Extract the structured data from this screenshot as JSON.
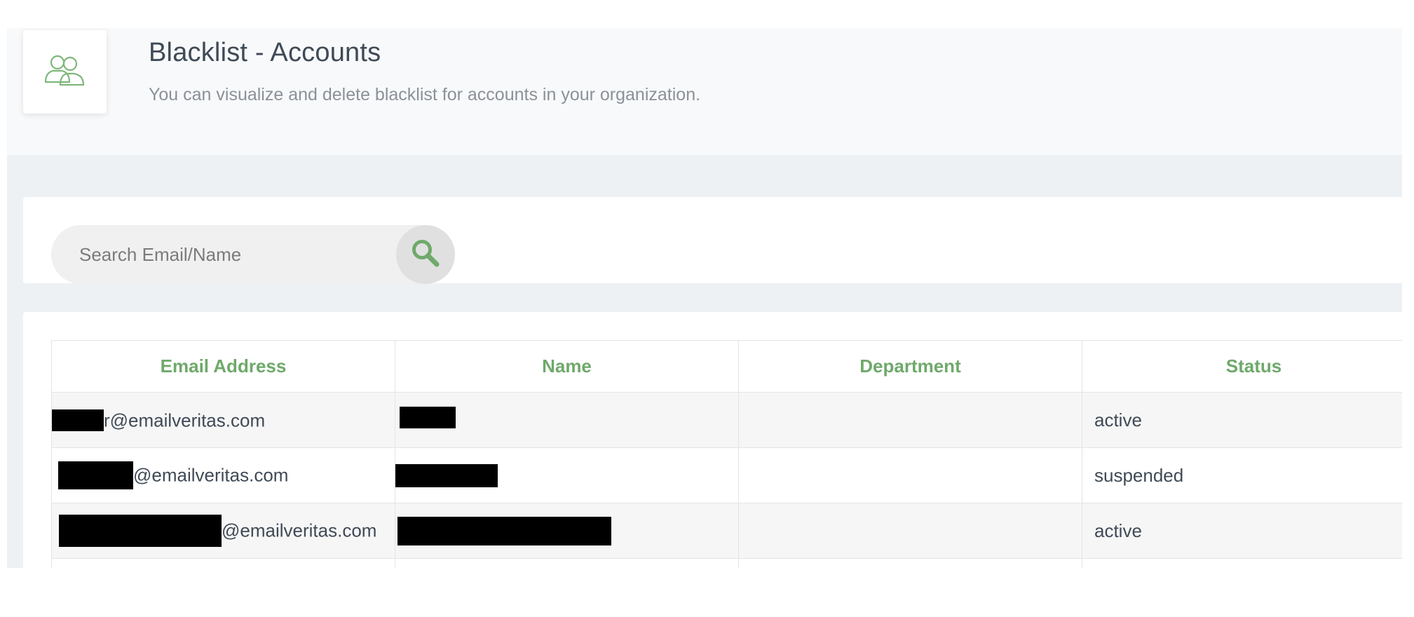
{
  "header": {
    "title": "Blacklist - Accounts",
    "subtitle": "You can visualize and delete blacklist for accounts in your organization.",
    "icon": "users-icon",
    "accent_color": "#6fa96b"
  },
  "search": {
    "placeholder": "Search Email/Name",
    "value": "",
    "button_icon": "search-icon"
  },
  "table": {
    "columns": [
      "Email Address",
      "Name",
      "Department",
      "Status"
    ],
    "rows": [
      {
        "email": "r@emailveritas.com",
        "name": "",
        "department": "",
        "status": "active"
      },
      {
        "email": "@emailveritas.com",
        "name": "",
        "department": "",
        "status": "suspended"
      },
      {
        "email": "@emailveritas.com",
        "name": "",
        "department": "",
        "status": "active"
      }
    ]
  }
}
